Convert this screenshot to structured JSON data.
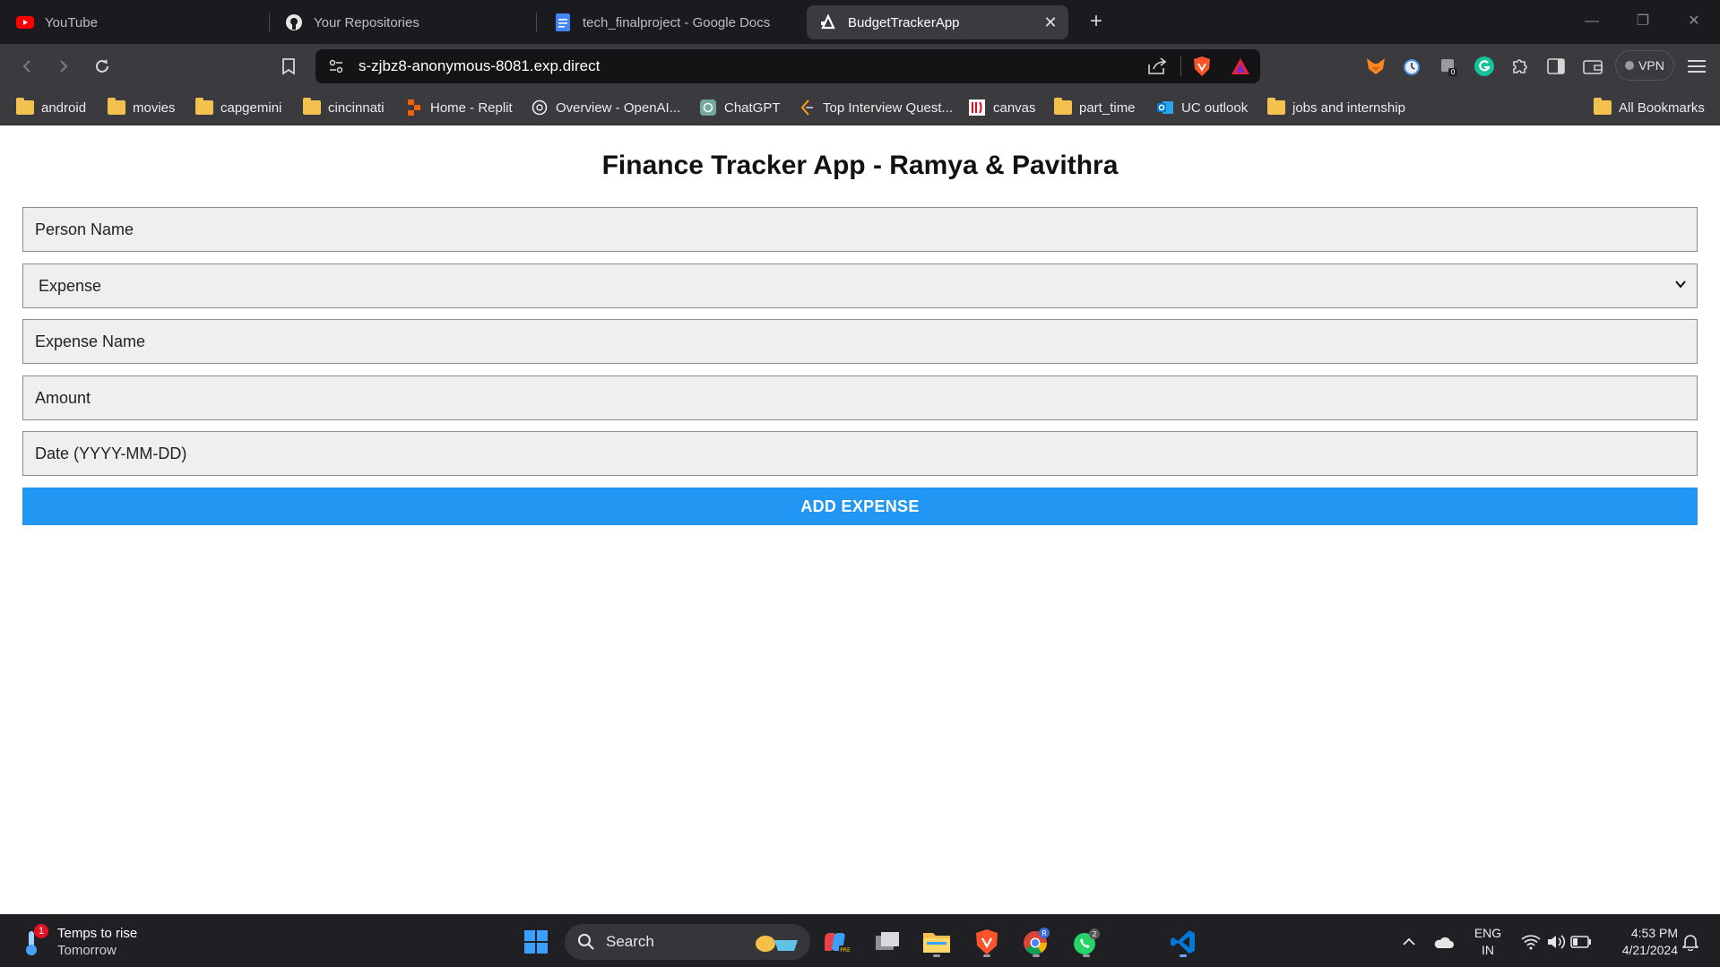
{
  "browser": {
    "tabs": [
      {
        "label": "YouTube",
        "icon": "youtube-icon"
      },
      {
        "label": "Your Repositories",
        "icon": "github-icon"
      },
      {
        "label": "tech_finalproject - Google Docs",
        "icon": "google-docs-icon"
      },
      {
        "label": "BudgetTrackerApp",
        "icon": "expo-icon"
      }
    ],
    "active_tab_index": 3,
    "url": "s-zjbz8-anonymous-8081.exp.direct",
    "vpn_label": "VPN",
    "extension_badge": "0",
    "bookmarks": [
      {
        "label": "android",
        "icon": "folder-icon"
      },
      {
        "label": "movies",
        "icon": "folder-icon"
      },
      {
        "label": "capgemini",
        "icon": "folder-icon"
      },
      {
        "label": "cincinnati",
        "icon": "folder-icon"
      },
      {
        "label": "Home - Replit",
        "icon": "replit-icon"
      },
      {
        "label": "Overview - OpenAI...",
        "icon": "openai-icon"
      },
      {
        "label": "ChatGPT",
        "icon": "chatgpt-icon"
      },
      {
        "label": "Top Interview Quest...",
        "icon": "leetcode-icon"
      },
      {
        "label": "canvas",
        "icon": "canvas-icon"
      },
      {
        "label": "part_time",
        "icon": "folder-icon"
      },
      {
        "label": "UC outlook",
        "icon": "outlook-icon"
      },
      {
        "label": "jobs and internship",
        "icon": "folder-icon"
      }
    ],
    "all_bookmarks_label": "All Bookmarks"
  },
  "app": {
    "title": "Finance Tracker App  - Ramya & Pavithra",
    "form": {
      "person_name_placeholder": "Person Name",
      "type_select_value": "Expense",
      "expense_name_placeholder": "Expense Name",
      "amount_placeholder": "Amount",
      "date_placeholder": "Date (YYYY-MM-DD)",
      "submit_label": "ADD EXPENSE"
    },
    "colors": {
      "accent": "#2196f3"
    }
  },
  "taskbar": {
    "weather_line1": "Temps to rise",
    "weather_line2": "Tomorrow",
    "weather_badge": "1",
    "search_label": "Search",
    "whatsapp_badge": "2",
    "chrome_badge": "R",
    "lang_line1": "ENG",
    "lang_line2": "IN",
    "time": "4:53 PM",
    "date": "4/21/2024"
  }
}
